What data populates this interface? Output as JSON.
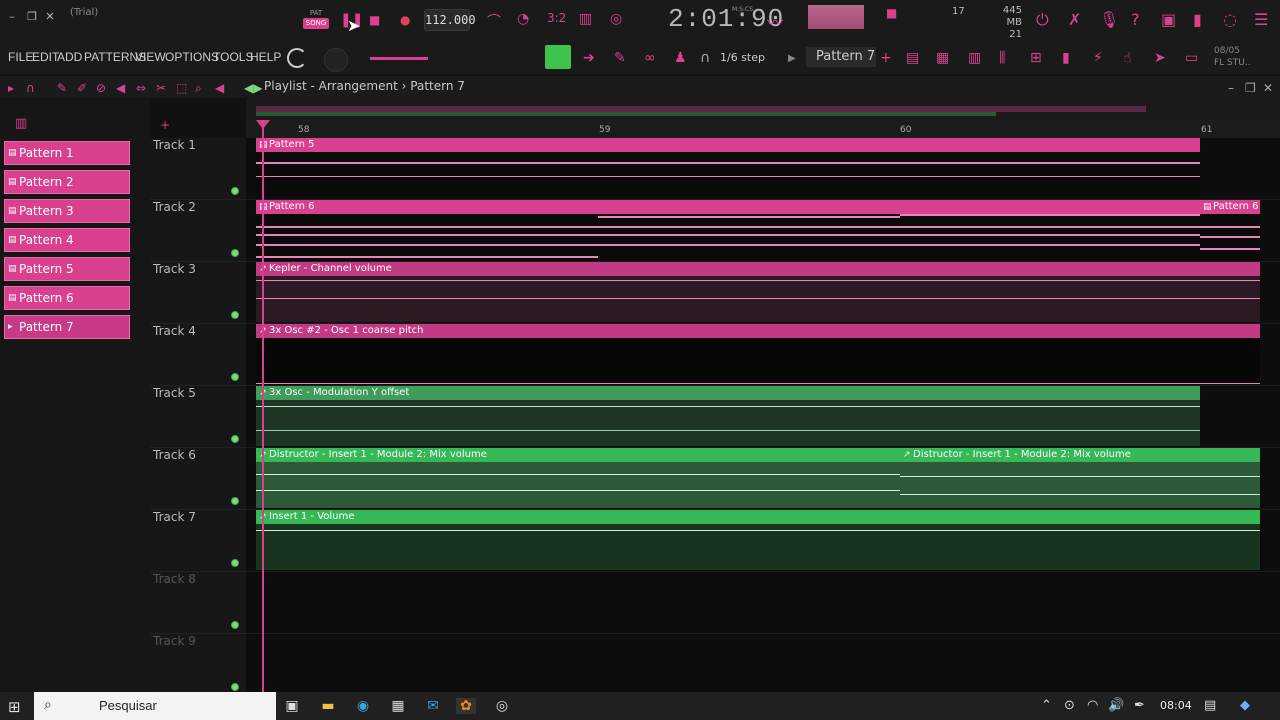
{
  "window": {
    "trial_label": "(Trial)"
  },
  "transport": {
    "pat_label": "PAT",
    "song_label": "SONG",
    "tempo": "112.000"
  },
  "time": {
    "display": "2:01:90",
    "sub": "M:S:CS"
  },
  "meter": {
    "cpu": "17",
    "mem_mb": "445 MB",
    "mem_sub": "21"
  },
  "menu": [
    "FILE",
    "EDIT",
    "ADD",
    "PATTERNS",
    "VIEW",
    "OPTIONS",
    "TOOLS",
    "HELP"
  ],
  "toolbar": {
    "step": "1/6 step",
    "pattern": "Pattern 7",
    "corner_date": "08/05",
    "corner_app": "FL STU.."
  },
  "playlist": {
    "title": "Playlist - Arrangement",
    "crumb_sep": "›",
    "current": "Pattern 7"
  },
  "patterns": [
    "Pattern 1",
    "Pattern 2",
    "Pattern 3",
    "Pattern 4",
    "Pattern 5",
    "Pattern 6",
    "Pattern 7"
  ],
  "bars": [
    "58",
    "59",
    "60",
    "61"
  ],
  "tracks": [
    "Track 1",
    "Track 2",
    "Track 3",
    "Track 4",
    "Track 5",
    "Track 6",
    "Track 7",
    "Track 8",
    "Track 9"
  ],
  "clips": {
    "t1": "Pattern 5",
    "t2a": "Pattern 6",
    "t2b": "Pattern 6",
    "t3": "Kepler - Channel volume",
    "t4": "3x Osc #2 - Osc 1 coarse pitch",
    "t5": "3x Osc - Modulation Y offset",
    "t6a": "Distructor - Insert 1 - Module 2: Mix volume",
    "t6b": "Distructor - Insert 1 - Module 2: Mix volume",
    "t7": "Insert 1 - Volume"
  },
  "taskbar": {
    "search": "Pesquisar",
    "time": "08:04"
  },
  "colors": {
    "accent": "#d9418f",
    "green": "#3f9c5a",
    "bright_green": "#36b857"
  }
}
